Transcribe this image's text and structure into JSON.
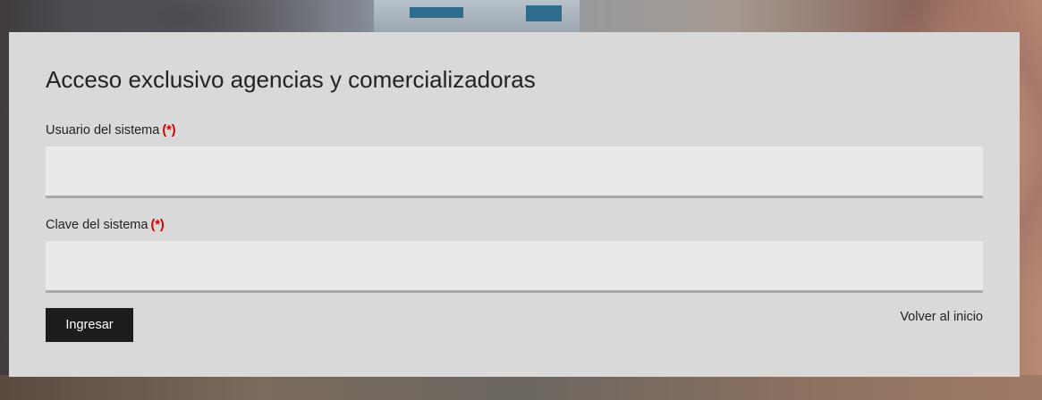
{
  "login": {
    "title": "Acceso exclusivo agencias y comercializadoras",
    "username": {
      "label": "Usuario del sistema",
      "required_mark": "(*)",
      "value": "",
      "placeholder": ""
    },
    "password": {
      "label": "Clave del sistema",
      "required_mark": "(*)",
      "value": "",
      "placeholder": ""
    },
    "submit_label": "Ingresar",
    "back_link": "Volver al inicio"
  },
  "colors": {
    "panel_bg": "#d9d9d9",
    "input_bg": "#e9e9e7",
    "button_bg": "#1d1d1d",
    "required": "#cc0000"
  }
}
